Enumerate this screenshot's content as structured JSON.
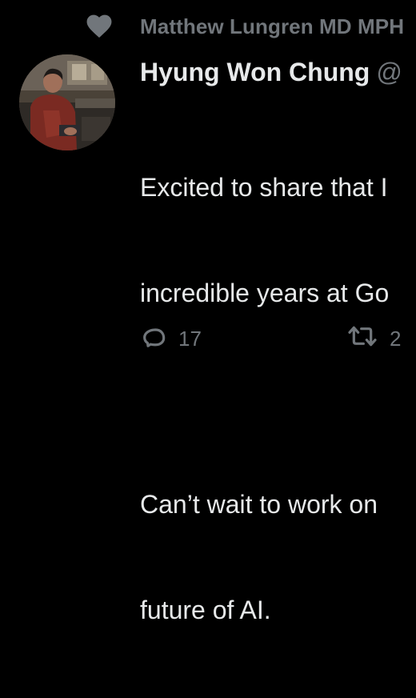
{
  "social_context": {
    "icon": "heart-icon",
    "text": "Matthew Lungren MD MPH"
  },
  "author": {
    "display_name": "Hyung Won Chung",
    "handle": "@"
  },
  "tweet": {
    "lines": [
      "Excited to share that I",
      "incredible years at Go",
      "",
      "Can’t wait to work on",
      "future of AI."
    ]
  },
  "actions": {
    "reply": {
      "icon": "reply-icon",
      "count": "17"
    },
    "retweet": {
      "icon": "retweet-icon",
      "count": "2"
    }
  },
  "colors": {
    "background": "#000000",
    "primary_text": "#e7e9ea",
    "secondary_text": "#71767b"
  }
}
